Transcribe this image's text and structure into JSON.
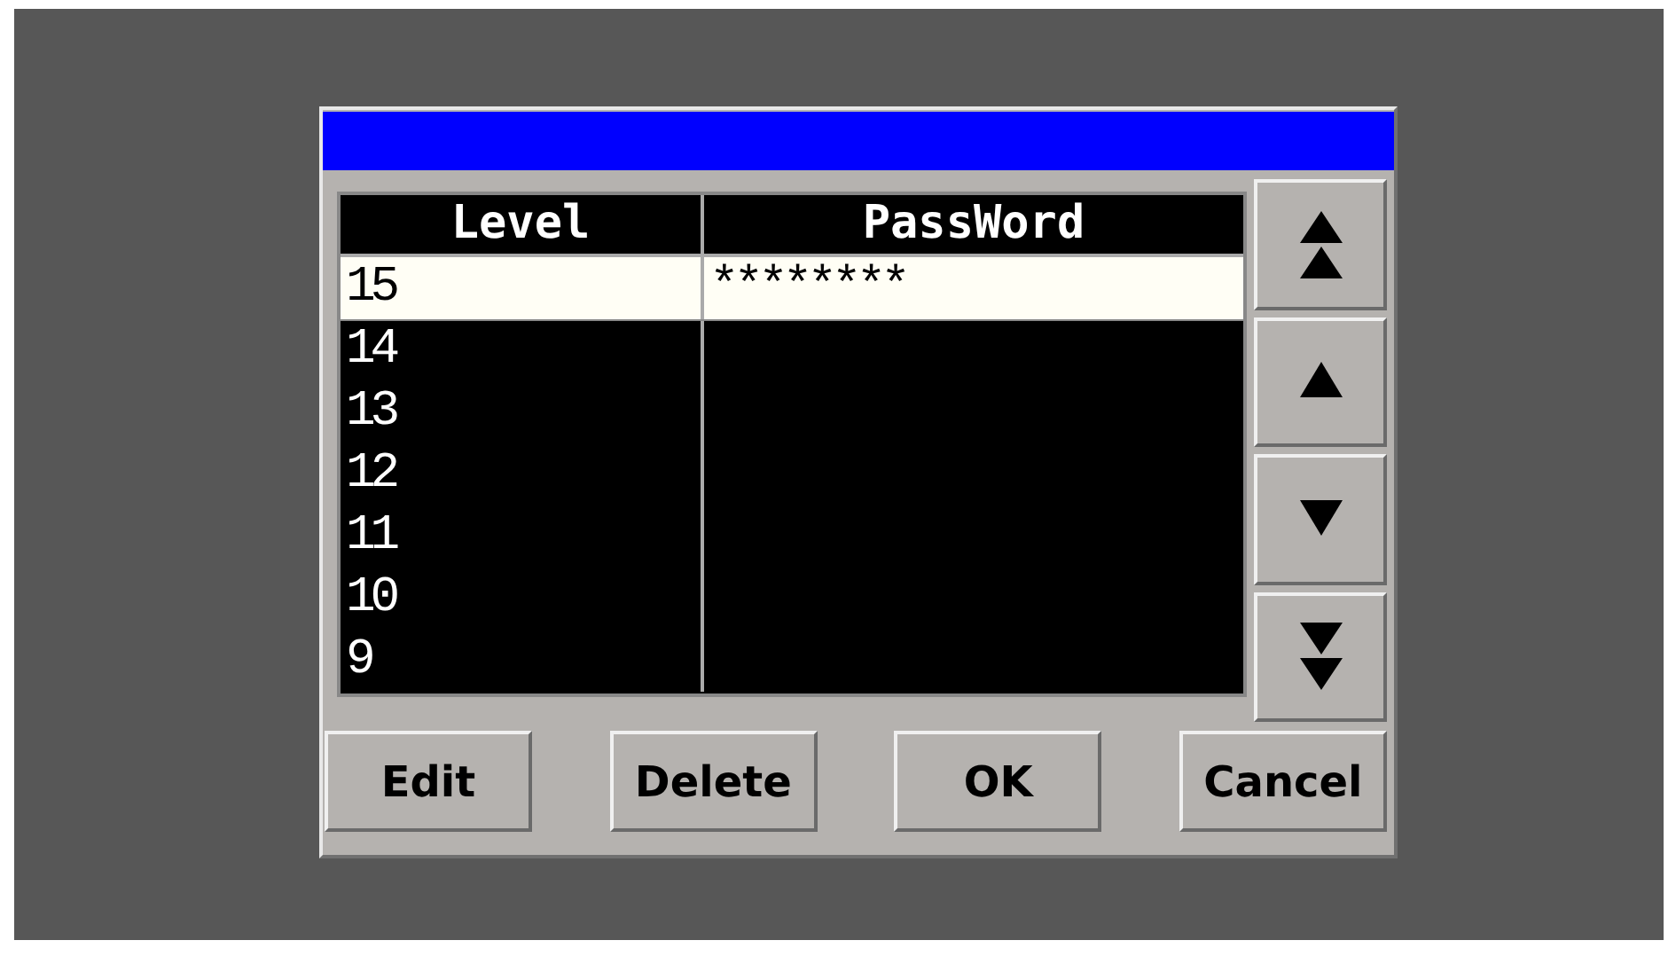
{
  "table": {
    "columns": [
      "Level",
      "PassWord"
    ],
    "rows": [
      {
        "level": "15",
        "password": "********",
        "selected": true
      },
      {
        "level": "14",
        "password": "",
        "selected": false
      },
      {
        "level": "13",
        "password": "",
        "selected": false
      },
      {
        "level": "12",
        "password": "",
        "selected": false
      },
      {
        "level": "11",
        "password": "",
        "selected": false
      },
      {
        "level": "10",
        "password": "",
        "selected": false
      },
      {
        "level": "9",
        "password": "",
        "selected": false
      }
    ]
  },
  "scroll_buttons": [
    {
      "kind": "first"
    },
    {
      "kind": "up"
    },
    {
      "kind": "down"
    },
    {
      "kind": "last"
    }
  ],
  "buttons": [
    "Edit",
    "Delete",
    "OK",
    "Cancel"
  ]
}
